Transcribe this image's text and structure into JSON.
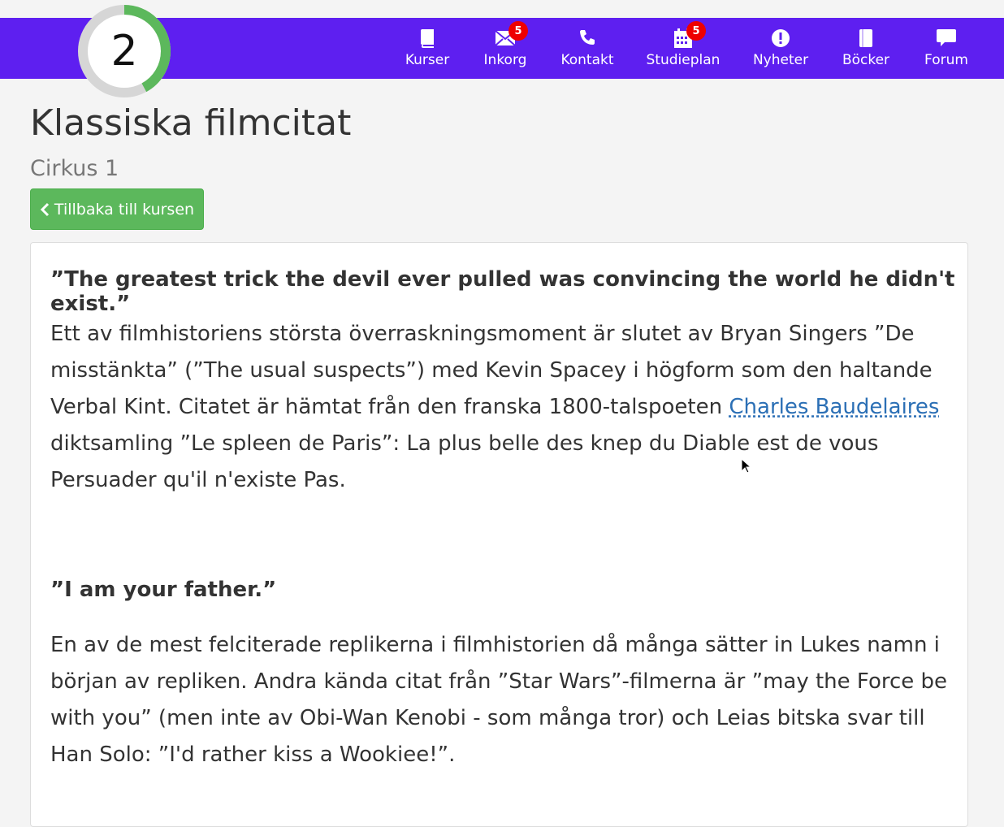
{
  "progress": {
    "value": "2",
    "fraction": 0.42
  },
  "nav": [
    {
      "label": "Kurser",
      "icon": "book-icon",
      "badge": ""
    },
    {
      "label": "Inkorg",
      "icon": "envelope-icon",
      "badge": "5"
    },
    {
      "label": "Kontakt",
      "icon": "phone-icon",
      "badge": ""
    },
    {
      "label": "Studieplan",
      "icon": "calendar-icon",
      "badge": "5"
    },
    {
      "label": "Nyheter",
      "icon": "exclamation-icon",
      "badge": ""
    },
    {
      "label": "Böcker",
      "icon": "book-icon",
      "badge": ""
    },
    {
      "label": "Forum",
      "icon": "chat-icon",
      "badge": ""
    }
  ],
  "page": {
    "title": "Klassiska filmcitat",
    "subtitle": "Cirkus 1",
    "back_label": "Tillbaka till kursen"
  },
  "content": {
    "quote1": "”The greatest trick the devil ever pulled was convincing the world he didn't exist.”",
    "para1_before": "Ett av filmhistoriens största överraskningsmoment är slutet av Bryan Singers ”De misstänkta” (”The usual suspects”) med Kevin Spacey i högform som den haltande Verbal Kint. Citatet är hämtat från den franska 1800-talspoeten ",
    "para1_link": "Charles Baudelaires",
    "para1_after": " diktsamling ”Le spleen de Paris”: La plus belle des knep du Diable est de vous Persuader qu'il n'existe Pas.",
    "quote2": "”I am your father.”",
    "para2": "En av de mest felciterade replikerna i filmhistorien då många sätter in Lukes namn i början av repliken. Andra kända citat från ”Star Wars”-filmerna är ”may the Force be with you” (men inte av Obi-Wan Kenobi - som många tror) och Leias bitska svar till Han Solo: ”I'd rather kiss a Wookiee!”."
  },
  "colors": {
    "header": "#5e1ff0",
    "progress": "#5cb85c",
    "button": "#5cb85c",
    "link": "#2b6fb5",
    "badge": "#e00000"
  }
}
